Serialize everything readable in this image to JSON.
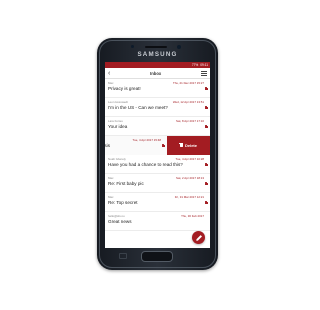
{
  "device": {
    "brand": "SAMSUNG"
  },
  "statusbar": {
    "battery": "77%",
    "time": "09:11"
  },
  "topbar": {
    "title": "Inbox",
    "back_icon": "chevron-left-icon",
    "menu_icon": "hamburger-menu-icon"
  },
  "messages": [
    {
      "sender": "Max",
      "date": "Thu, 21 Dec 2017 15:27",
      "subject": "Privacy is great!"
    },
    {
      "sender": "Leon Hosswedt",
      "date": "Wed, 12 Apr 2017 13:51",
      "subject": "I'm in the US - Can we meet?"
    },
    {
      "sender": "Lara Fortes",
      "date": "Sat, 8 Apr 2017 17:10",
      "subject": "Your idea"
    },
    {
      "sender": "",
      "date": "Tue, 4 Apr 2017 15:48",
      "subject": "thesis"
    },
    {
      "sender": "Noah Gberely",
      "date": "Tue, 4 Apr 2017 10:28",
      "subject": "Have you had a chance to read this?"
    },
    {
      "sender": "Max",
      "date": "Sat, 2 Apr 2017 18:13",
      "subject": "Re: First baby pic"
    },
    {
      "sender": "Max",
      "date": "Fri, 31 Mar 2017 12:21",
      "subject": "Re: Top secret"
    },
    {
      "sender": "hello@sbo.io",
      "date": "Thu, 30 Feb 2017",
      "subject": "Great news"
    }
  ],
  "swipe_action": {
    "label": "Delete",
    "icon": "trash-icon"
  },
  "fab": {
    "icon": "pencil-icon"
  },
  "colors": {
    "accent": "#a31c22"
  }
}
